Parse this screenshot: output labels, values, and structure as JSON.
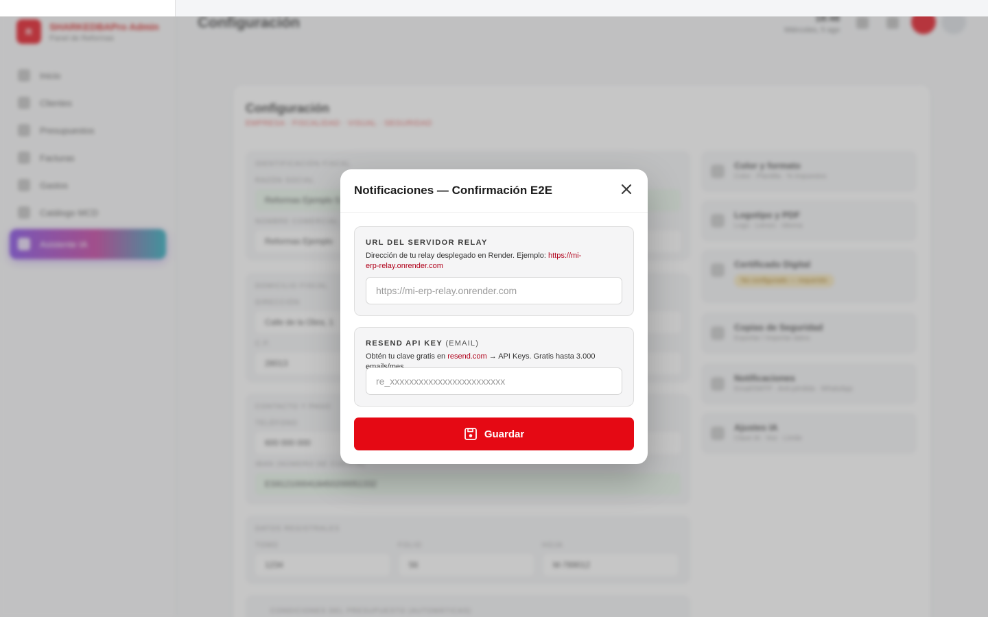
{
  "app": {
    "brand_name": "SHARKEDBAPro Admin",
    "brand_sub": "Panel de Reformas",
    "logo_text": "R",
    "nav": [
      {
        "label": "Inicio"
      },
      {
        "label": "Clientes"
      },
      {
        "label": "Presupuestos"
      },
      {
        "label": "Facturas"
      },
      {
        "label": "Gastos"
      },
      {
        "label": "Catálogo MCD"
      },
      {
        "label": "Asistente IA"
      }
    ],
    "page_heading": "Configuración",
    "clock_time": "18:48",
    "clock_date": "Miércoles, 5 ago"
  },
  "settings": {
    "title": "Configuración",
    "subtitle": "EMPRESA · FISCALIDAD · VISUAL · SEGURIDAD",
    "sections": {
      "ident_label": "IDENTIFICACIÓN FISCAL",
      "razon_label": "RAZÓN SOCIAL",
      "razon_value": "Reformas Ejemplo S.L.",
      "nombre_label": "NOMBRE COMERCIAL",
      "nombre_value": "Reformas Ejemplo",
      "domicilio_label": "DOMICILIO FISCAL",
      "direccion_label": "DIRECCIÓN",
      "direccion_value": "Calle de la Obra, 1",
      "cp_label": "C.P.",
      "cp_value": "28013",
      "contacto_label": "CONTACTO Y PAGO",
      "telefono_label": "TELÉFONO",
      "telefono_value": "600 000 000",
      "iban_label": "IBAN (NÚMERO DE CUENTA)",
      "iban_value": "ES9121000418450200051332",
      "registro_label": "DATOS REGISTRALES",
      "tomo_label": "TOMO",
      "tomo_value": "1234",
      "folio_label": "FOLIO",
      "folio_value": "56",
      "hoja_label": "HOJA",
      "hoja_value": "M-789012",
      "condiciones_label": "CONDICIONES DEL PRESUPUESTO (AUTOMÁTICAS)"
    },
    "side_items": [
      {
        "title": "Color y formato",
        "sub": "Color · Plantilla · % Impuestos"
      },
      {
        "title": "Logotipo y PDF",
        "sub": "Logo · Lienzo · Idioma"
      },
      {
        "title": "Certificado Digital",
        "sub": "No configurado — requerido"
      },
      {
        "title": "Copias de Seguridad",
        "sub": "Exportar / Importar datos"
      },
      {
        "title": "Notificaciones",
        "sub": "Email/SMTP · Anti-pérdida · WhatsApp"
      },
      {
        "title": "Ajustes IA",
        "sub": "Clave IA · Voz · Límite"
      }
    ]
  },
  "modal": {
    "title": "Notificaciones — Confirmación E2E",
    "relay": {
      "label": "URL DEL SERVIDOR RELAY",
      "hint_text": "Dirección de tu relay desplegado en Render. Ejemplo: ",
      "hint_link": "https://mi-erp-relay.onrender.com",
      "placeholder": "https://mi-erp-relay.onrender.com",
      "value": ""
    },
    "resend": {
      "label_bold": "RESEND API KEY",
      "label_thin": "(EMAIL)",
      "hint_pre": "Obtén tu clave gratis en ",
      "hint_link": "resend.com",
      "hint_post": " → API Keys. Gratis hasta 3.000 emails/mes.",
      "placeholder": "re_xxxxxxxxxxxxxxxxxxxxxxxx",
      "value": ""
    },
    "save_label": "Guardar"
  },
  "colors": {
    "accent": "#e50914",
    "link": "#b0001a",
    "overlay": "rgba(120,120,120,0.42)"
  },
  "icons": [
    "close-icon",
    "save-icon"
  ]
}
